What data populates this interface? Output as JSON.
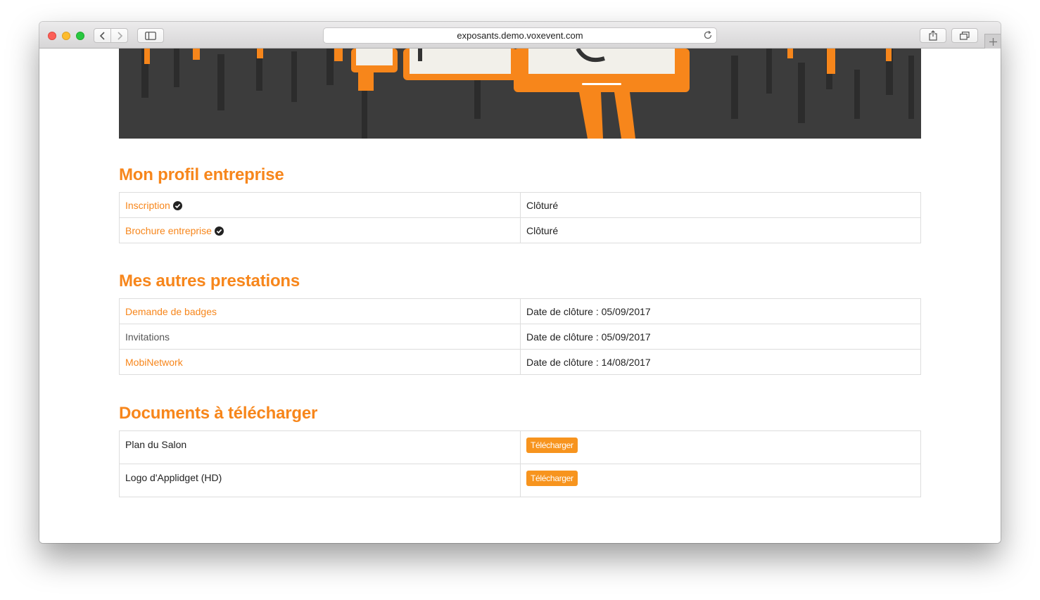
{
  "browser": {
    "url": "exposants.demo.voxevent.com"
  },
  "colors": {
    "accent": "#f7861b",
    "button": "#f7941e",
    "banner_bg": "#3c3c3c"
  },
  "sections": {
    "profile": {
      "title": "Mon profil entreprise",
      "rows": [
        {
          "label": "Inscription",
          "status": "Clôturé",
          "icon": "check-circle-icon"
        },
        {
          "label": "Brochure entreprise",
          "status": "Clôturé",
          "icon": "check-circle-icon"
        }
      ]
    },
    "services": {
      "title": "Mes autres prestations",
      "rows": [
        {
          "label": "Demande de badges",
          "status": "Date de clôture : 05/09/2017"
        },
        {
          "label": "Invitations",
          "status": "Date de clôture : 05/09/2017"
        },
        {
          "label": "MobiNetwork",
          "status": "Date de clôture : 14/08/2017"
        }
      ]
    },
    "documents": {
      "title": "Documents à télécharger",
      "rows": [
        {
          "label": "Plan du Salon",
          "button": "Télécharger"
        },
        {
          "label": "Logo d'Applidget (HD)",
          "button": "Télécharger"
        }
      ]
    }
  }
}
